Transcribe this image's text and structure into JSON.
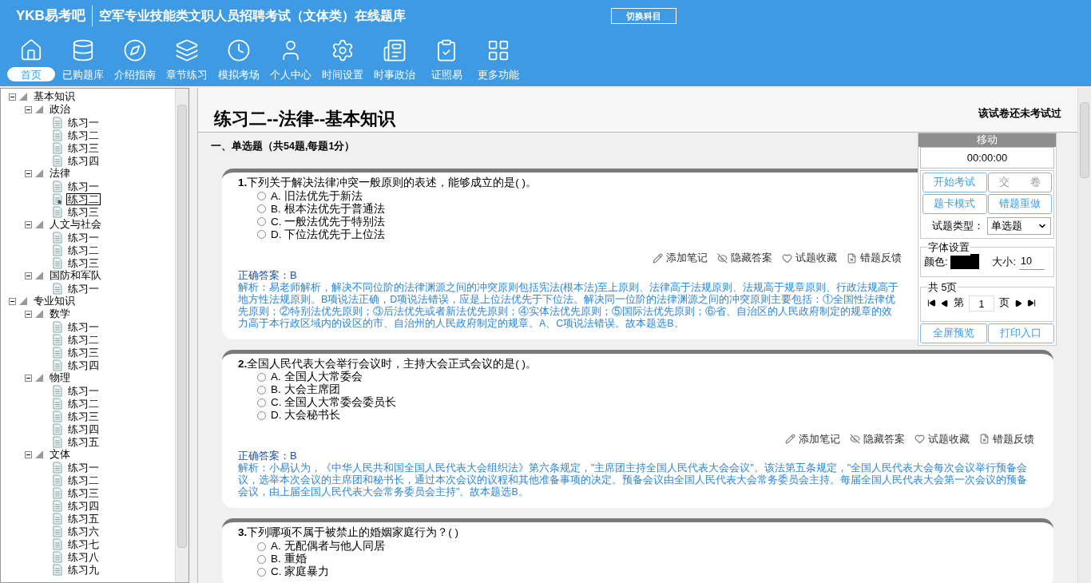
{
  "app": {
    "logo": "YKB易考吧",
    "title": "空军专业技能类文职人员招聘考试（文体类）在线题库",
    "switch_button": "切换科目"
  },
  "toolbar": [
    {
      "label": "首页",
      "selected": true
    },
    {
      "label": "已购题库",
      "selected": false
    },
    {
      "label": "介绍指南",
      "selected": false
    },
    {
      "label": "章节练习",
      "selected": false
    },
    {
      "label": "模拟考场",
      "selected": false
    },
    {
      "label": "个人中心",
      "selected": false
    },
    {
      "label": "时间设置",
      "selected": false
    },
    {
      "label": "时事政治",
      "selected": false
    },
    {
      "label": "证照易",
      "selected": false
    },
    {
      "label": "更多功能",
      "selected": false
    }
  ],
  "tree": [
    {
      "label": "基本知识",
      "expanded": true,
      "children": [
        {
          "label": "政治",
          "expanded": true,
          "children": [
            {
              "label": "练习一",
              "selected": false
            },
            {
              "label": "练习二",
              "selected": false
            },
            {
              "label": "练习三",
              "selected": false
            },
            {
              "label": "练习四",
              "selected": false
            }
          ]
        },
        {
          "label": "法律",
          "expanded": true,
          "children": [
            {
              "label": "练习一",
              "selected": false
            },
            {
              "label": "练习二",
              "selected": true
            },
            {
              "label": "练习三",
              "selected": false
            }
          ]
        },
        {
          "label": "人文与社会",
          "expanded": true,
          "children": [
            {
              "label": "练习一",
              "selected": false
            },
            {
              "label": "练习二",
              "selected": false
            },
            {
              "label": "练习三",
              "selected": false
            }
          ]
        },
        {
          "label": "国防和军队",
          "expanded": true,
          "children": [
            {
              "label": "练习一",
              "selected": false
            }
          ]
        }
      ]
    },
    {
      "label": "专业知识",
      "expanded": true,
      "children": [
        {
          "label": "数学",
          "expanded": true,
          "children": [
            {
              "label": "练习一",
              "selected": false
            },
            {
              "label": "练习二",
              "selected": false
            },
            {
              "label": "练习三",
              "selected": false
            },
            {
              "label": "练习四",
              "selected": false
            }
          ]
        },
        {
          "label": "物理",
          "expanded": true,
          "children": [
            {
              "label": "练习一",
              "selected": false
            },
            {
              "label": "练习二",
              "selected": false
            },
            {
              "label": "练习三",
              "selected": false
            },
            {
              "label": "练习四",
              "selected": false
            },
            {
              "label": "练习五",
              "selected": false
            }
          ]
        },
        {
          "label": "文体",
          "expanded": true,
          "children": [
            {
              "label": "练习一",
              "selected": false
            },
            {
              "label": "练习二",
              "selected": false
            },
            {
              "label": "练习三",
              "selected": false
            },
            {
              "label": "练习四",
              "selected": false
            },
            {
              "label": "练习五",
              "selected": false
            },
            {
              "label": "练习六",
              "selected": false
            },
            {
              "label": "练习七",
              "selected": false
            },
            {
              "label": "练习八",
              "selected": false
            },
            {
              "label": "练习九",
              "selected": false
            }
          ]
        }
      ]
    }
  ],
  "paper": {
    "title": "练习二--法律--基本知识",
    "status": "该试卷还未考试过",
    "section": "一、单选题（共54题,每题1分）"
  },
  "questions": [
    {
      "number": "1.",
      "text": "下列关于解决法律冲突一般原则的表述，能够成立的是( )。",
      "options": [
        {
          "label": "A.",
          "text": "旧法优先于新法",
          "selected": false
        },
        {
          "label": "B.",
          "text": "根本法优先于普通法",
          "selected": false
        },
        {
          "label": "C.",
          "text": "一般法优先于特别法",
          "selected": false
        },
        {
          "label": "D.",
          "text": "下位法优先于上位法",
          "selected": false
        }
      ],
      "actions": [
        "添加笔记",
        "隐藏答案",
        "试题收藏",
        "错题反馈"
      ],
      "answer_label": "正确答案：",
      "answer": "B",
      "analysis": "解析：易老师解析，解决不同位阶的法律渊源之间的冲突原则包括宪法(根本法)至上原则、法律高于法规原则、法规高于规章原则、行政法规高于地方性法规原则。B项说法正确，D项说法错误，应是上位法优先于下位法。解决同一位阶的法律渊源之间的冲突原则主要包括：①全国性法律优先原则；②特别法优先原则；③后法优先或者新法优先原则；④实体法优先原则；⑤国际法优先原则；⑥省、自治区的人民政府制定的规章的效力高于本行政区域内的设区的市、自治州的人民政府制定的规章。A、C项说法错误。故本题选B。"
    },
    {
      "number": "2.",
      "text": "全国人民代表大会举行会议时，主持大会正式会议的是( )。",
      "options": [
        {
          "label": "A.",
          "text": "全国人大常委会",
          "selected": false
        },
        {
          "label": "B.",
          "text": "大会主席团",
          "selected": false
        },
        {
          "label": "C.",
          "text": "全国人大常委会委员长",
          "selected": false
        },
        {
          "label": "D.",
          "text": "大会秘书长",
          "selected": false
        }
      ],
      "actions": [
        "添加笔记",
        "隐藏答案",
        "试题收藏",
        "错题反馈"
      ],
      "answer_label": "正确答案：",
      "answer": "B",
      "analysis": "解析：小易认为，《中华人民共和国全国人民代表大会组织法》第六条规定，\"主席团主持全国人民代表大会会议\"。该法第五条规定，\"全国人民代表大会每次会议举行预备会议，选举本次会议的主席团和秘书长，通过本次会议的议程和其他准备事项的决定。预备会议由全国人民代表大会常务委员会主持。每届全国人民代表大会第一次会议的预备会议，由上届全国人民代表大会常务委员会主持\"。故本题选B。"
    },
    {
      "number": "3.",
      "text": "下列哪项不属于被禁止的婚姻家庭行为？( )",
      "options": [
        {
          "label": "A.",
          "text": "无配偶者与他人同居",
          "selected": false
        },
        {
          "label": "B.",
          "text": "重婚",
          "selected": false
        },
        {
          "label": "C.",
          "text": "家庭暴力",
          "selected": false
        }
      ]
    }
  ],
  "panel": {
    "header": "移动",
    "timer": "00:00:00",
    "buttons": [
      {
        "label": "开始考试",
        "disabled": false
      },
      {
        "label": "交　　卷",
        "disabled": true
      },
      {
        "label": "题卡模式",
        "disabled": false
      },
      {
        "label": "错题重做",
        "disabled": false
      }
    ],
    "type_label": "试题类型：",
    "type_value": "单选题",
    "font_legend": "字体设置",
    "color_label": "颜色:",
    "color": "#000000",
    "size_label": "大小:",
    "size_value": "10",
    "pages_legend": "共 5页",
    "page_prefix": "第",
    "page_value": "1",
    "page_suffix": "页",
    "bottom_buttons": [
      {
        "label": "全屏预览",
        "disabled": false
      },
      {
        "label": "打印入口",
        "disabled": false
      }
    ]
  }
}
